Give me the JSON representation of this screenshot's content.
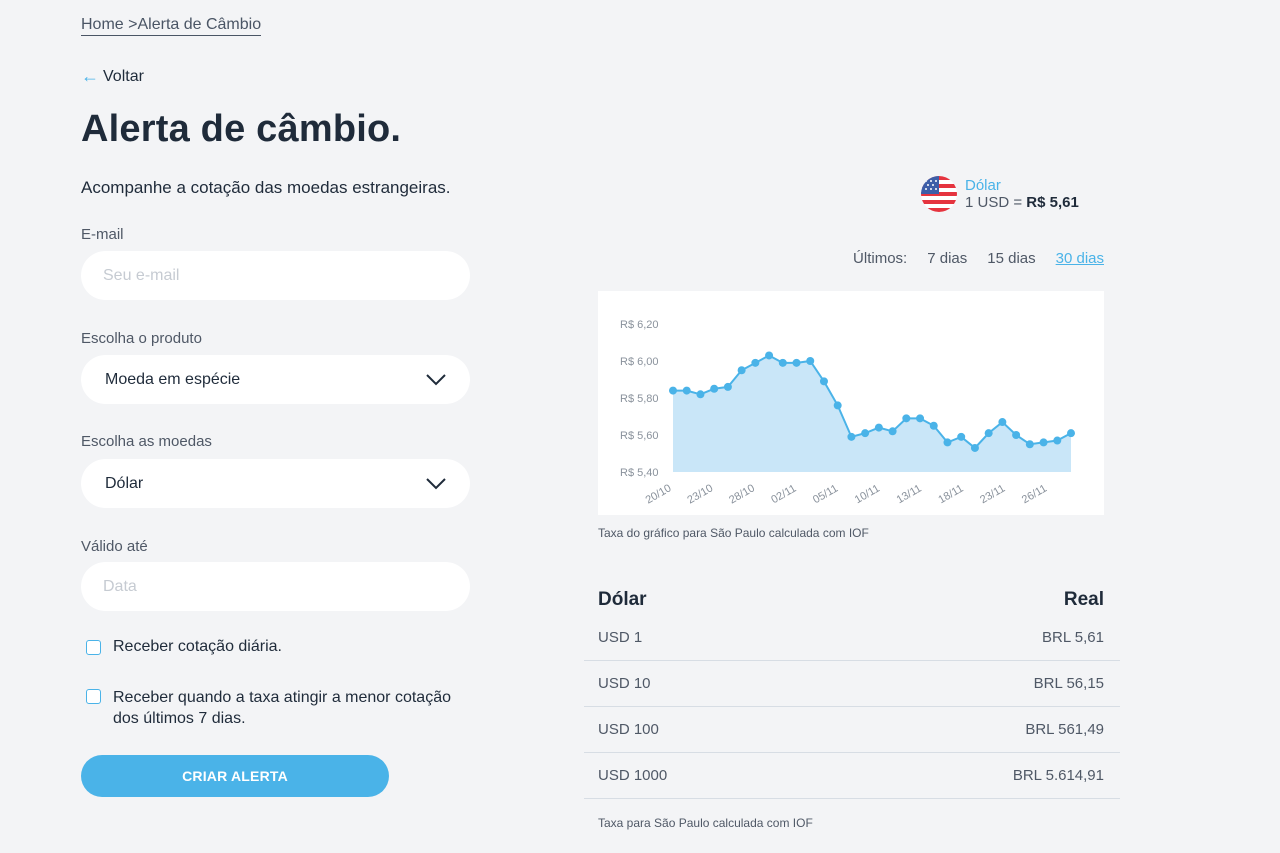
{
  "breadcrumb": {
    "home": "Home",
    "separator": ">",
    "current": "Alerta de Câmbio"
  },
  "back_label": "Voltar",
  "page_title": "Alerta de câmbio.",
  "subtitle": "Acompanhe a cotação das moedas estrangeiras.",
  "form": {
    "email_label": "E-mail",
    "email_placeholder": "Seu e-mail",
    "product_label": "Escolha o produto",
    "product_value": "Moeda em espécie",
    "currency_label": "Escolha as moedas",
    "currency_value": "Dólar",
    "valid_label": "Válido até",
    "date_placeholder": "Data",
    "check_daily": "Receber cotação diária.",
    "check_lowest_line1": "Receber quando a taxa atingir a menor cotação",
    "check_lowest_line2": "dos últimos 7 dias.",
    "submit_label": "CRIAR ALERTA"
  },
  "currency_card": {
    "name": "Dólar",
    "rate_prefix": "1 USD =",
    "rate_value": "R$ 5,61",
    "flag_icon": "us-flag-icon"
  },
  "period": {
    "label": "Últimos:",
    "options": [
      "7 dias",
      "15 dias",
      "30 dias"
    ],
    "active": "30 dias"
  },
  "chart_data": {
    "type": "area",
    "y_ticks": [
      "R$ 6,20",
      "R$ 6,00",
      "R$ 5,80",
      "R$ 5,60",
      "R$ 5,40"
    ],
    "ylim": [
      5.4,
      6.2
    ],
    "x_ticks": [
      "20/10",
      "23/10",
      "28/10",
      "02/11",
      "05/11",
      "10/11",
      "13/11",
      "18/11",
      "23/11",
      "26/11"
    ],
    "values": [
      5.84,
      5.84,
      5.82,
      5.85,
      5.86,
      5.95,
      5.99,
      6.03,
      5.99,
      5.99,
      6.0,
      5.89,
      5.76,
      5.59,
      5.61,
      5.64,
      5.62,
      5.69,
      5.69,
      5.65,
      5.56,
      5.59,
      5.53,
      5.61,
      5.67,
      5.6,
      5.55,
      5.56,
      5.57,
      5.61
    ],
    "fill_color": "#c9e6f8",
    "line_color": "#4ab3e8",
    "grid": false
  },
  "chart_note": "Taxa do gráfico para São Paulo calculada com IOF",
  "table": {
    "header_left": "Dólar",
    "header_right": "Real",
    "rows": [
      {
        "usd": "USD 1",
        "brl": "BRL 5,61"
      },
      {
        "usd": "USD 10",
        "brl": "BRL 56,15"
      },
      {
        "usd": "USD 100",
        "brl": "BRL 561,49"
      },
      {
        "usd": "USD 1000",
        "brl": "BRL 5.614,91"
      }
    ]
  },
  "table_note": "Taxa para São Paulo calculada com IOF",
  "colors": {
    "accent": "#4ab3e8",
    "background": "#f3f4f6",
    "text": "#1f2b3a"
  }
}
